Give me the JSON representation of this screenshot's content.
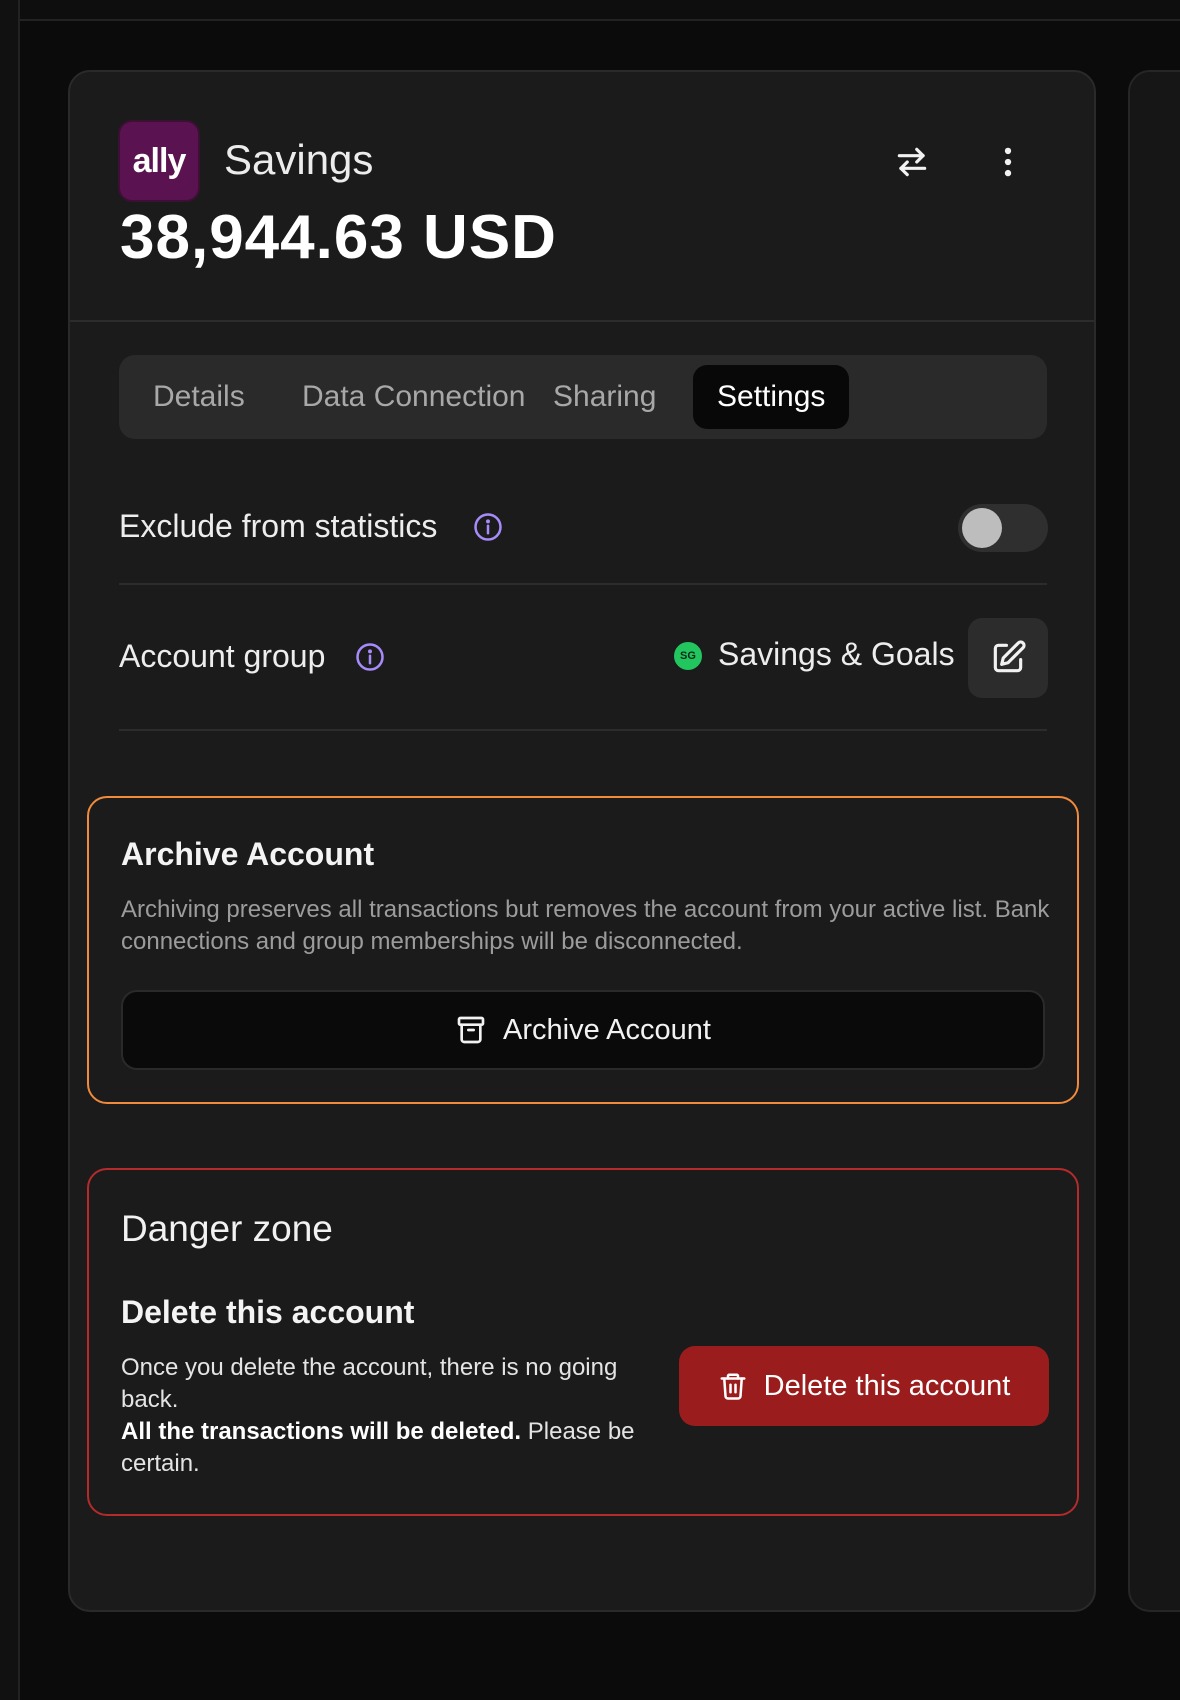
{
  "account": {
    "logo_text": "ally",
    "name": "Savings",
    "balance": "38,944.63 USD"
  },
  "icons": {
    "transfer": "transfer-arrows-icon",
    "more": "more-vertical-icon",
    "info": "info-circle-icon",
    "edit": "edit-icon",
    "archive": "archive-box-icon",
    "trash": "trash-icon"
  },
  "tabs": [
    {
      "label": "Details",
      "active": false
    },
    {
      "label": "Data Connection",
      "active": false
    },
    {
      "label": "Sharing",
      "active": false
    },
    {
      "label": "Settings",
      "active": true
    }
  ],
  "settings": {
    "exclude_label": "Exclude from statistics",
    "exclude_enabled": false,
    "group_label": "Account group",
    "group_badge": "SG",
    "group_name": "Savings & Goals"
  },
  "archive": {
    "title": "Archive Account",
    "description": "Archiving preserves all transactions but removes the account from your active list. Bank connections and group memberships will be disconnected.",
    "button_label": "Archive Account"
  },
  "danger": {
    "title": "Danger zone",
    "delete_title": "Delete this account",
    "delete_desc_1": "Once you delete the account, there is no going back.",
    "delete_desc_bold": "All the transactions will be deleted.",
    "delete_desc_2": " Please be certain.",
    "delete_button_label": "Delete this account"
  },
  "colors": {
    "archive_border": "#f08a3c",
    "danger_border": "#b52a2a",
    "danger_button": "#9b1c1c",
    "info_icon": "#a78bfa",
    "group_badge": "#22c55e",
    "logo_bg": "#5a1350"
  }
}
